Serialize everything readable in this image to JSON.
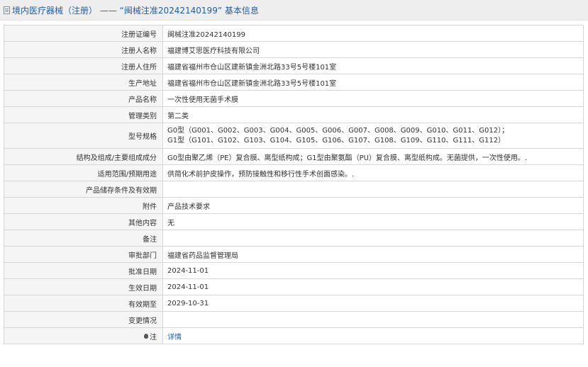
{
  "header": {
    "title": "境内医疗器械（注册） —— “闽械注准20242140199” 基本信息"
  },
  "rows": [
    {
      "label": "注册证编号",
      "value": "闽械注准20242140199"
    },
    {
      "label": "注册人名称",
      "value": "福建博艾思医疗科技有限公司"
    },
    {
      "label": "注册人住所",
      "value": "福建省福州市仓山区建新镇金洲北路33号5号楼101室"
    },
    {
      "label": "生产地址",
      "value": "福建省福州市仓山区建新镇金洲北路33号5号楼101室"
    },
    {
      "label": "产品名称",
      "value": "一次性使用无菌手术膜"
    },
    {
      "label": "管理类别",
      "value": "第二类"
    },
    {
      "label": "型号规格",
      "value_lines": [
        "G0型（G001、G002、G003、G004、G005、G006、G007、G008、G009、G010、G011、G012）；",
        "G1型（G101、G102、G103、G104、G105、G106、G107、G108、G109、G110、G111、G112）"
      ]
    },
    {
      "label": "结构及组成/主要组成成分",
      "value": "G0型由聚乙烯（PE）复合膜、离型纸构成；G1型由聚氨酯（PU）复合膜、离型纸构成。无菌提供，一次性使用。."
    },
    {
      "label": "适用范围/预期用途",
      "value": "供简化术前护皮操作，预防接触性和移行性手术创面感染。."
    },
    {
      "label": "产品储存条件及有效期",
      "value": ""
    },
    {
      "label": "附件",
      "value": "产品技术要求"
    },
    {
      "label": "其他内容",
      "value": "无"
    },
    {
      "label": "备注",
      "value": ""
    },
    {
      "label": "审批部门",
      "value": "福建省药品监督管理局"
    },
    {
      "label": "批准日期",
      "value": "2024-11-01"
    },
    {
      "label": "生效日期",
      "value": "2024-11-01"
    },
    {
      "label": "有效期至",
      "value": "2029-10-31"
    },
    {
      "label": "变更情况",
      "value": ""
    },
    {
      "label": "注",
      "value": "详情",
      "icon": "lightbulb-icon"
    }
  ]
}
